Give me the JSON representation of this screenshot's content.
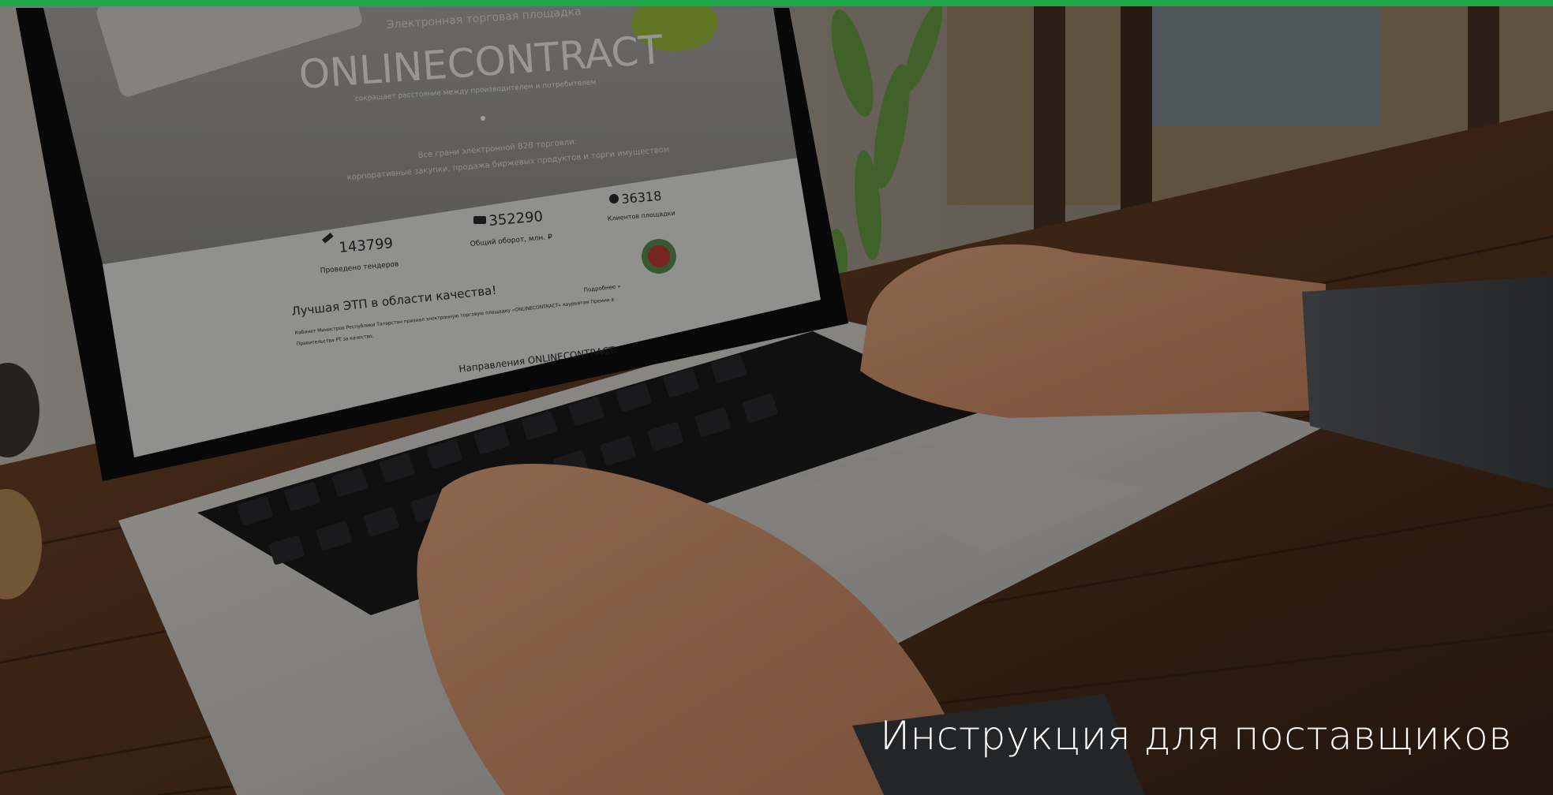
{
  "caption": "Инструкция для поставщиков",
  "screen": {
    "kicker": "Электронная торговая площадка",
    "brand": "ONLINECONTRACT",
    "tagline": "сокращает расстояние между производителем и потребителем",
    "desc_line1": "Все грани электронной B2B торговли:",
    "desc_line2": "корпоративные закупки, продажа биржевых продуктов и торги имуществом",
    "stats": [
      {
        "value": "143799",
        "label": "Проведено тендеров",
        "icon": "gavel-icon"
      },
      {
        "value": "352290",
        "label": "Общий оборот, млн. ₽",
        "icon": "money-icon"
      },
      {
        "value": "36318",
        "label": "Клиентов площадки",
        "icon": "users-icon"
      }
    ],
    "award_title": "Лучшая ЭТП в области качества!",
    "award_text_1": "Кабинет Министров Республики Татарстан признал электронную торговую площадку «ONLINECONTRACT» лауреатом Премии в",
    "award_text_2": "Правительства РТ за качество.",
    "award_more": "Подробнее »",
    "directions": "Направления ONLINECONTRACT:"
  },
  "colors": {
    "accent": "#1fa84a",
    "caption": "#ffffff"
  }
}
